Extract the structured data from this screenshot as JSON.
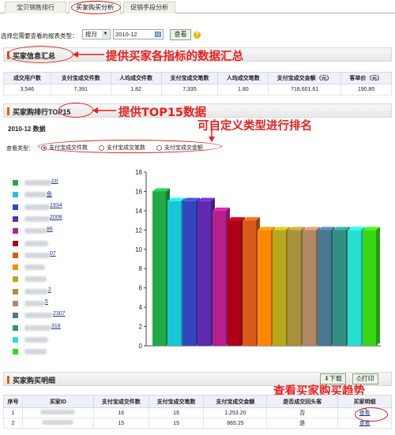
{
  "tabs": [
    {
      "label": "宝贝销售排行"
    },
    {
      "label": "买家购买分析"
    },
    {
      "label": "促销手段分析"
    }
  ],
  "query": {
    "label": "选择您需要查看的报表类型：",
    "period_value": "按月",
    "date_value": "2010-12",
    "view_button": "查看"
  },
  "summary": {
    "title": "买家信息汇总",
    "annotation": "提供买家各指标的数据汇总",
    "headers": [
      "成交用户数",
      "支付宝成交件数",
      "人均成交件数",
      "支付宝成交笔数",
      "人均成交笔数",
      "支付宝成交金额（元）",
      "客单价（元）"
    ],
    "values": [
      "3,546",
      "7,391",
      "1.82",
      "7,335",
      "1.80",
      "718,601.61",
      "190.80"
    ]
  },
  "top": {
    "title_prefix": "买家购排行",
    "title_highlight": "TOP15",
    "annotation": "提供TOP15数据",
    "annotation2": "可自定义类型进行排名",
    "data_label": "2010-12 数据",
    "type_label": "查看类型：",
    "radio_options": [
      "支付宝成交件数",
      "支付宝成交笔数",
      "支付宝成交金额"
    ],
    "selected_index": 0
  },
  "legend": [
    {
      "label": "zzi",
      "color": "#22aa44"
    },
    {
      "label": "鱼",
      "color": "#19c6d9"
    },
    {
      "label": "1934",
      "color": "#3346c0"
    },
    {
      "label": "2008",
      "color": "#5d2ab0"
    },
    {
      "label": "86",
      "color": "#b4208c"
    },
    {
      "label": "",
      "color": "#b00018"
    },
    {
      "label": "07",
      "color": "#d85a18"
    },
    {
      "label": "",
      "color": "#ff8800"
    },
    {
      "label": "",
      "color": "#b7a91d"
    },
    {
      "label": "2",
      "color": "#a8903c"
    },
    {
      "label": "5",
      "color": "#b28766"
    },
    {
      "label": "2307",
      "color": "#4a7890"
    },
    {
      "label": "318",
      "color": "#338f84"
    },
    {
      "label": "",
      "color": "#26e0d2"
    },
    {
      "label": "",
      "color": "#38d616"
    }
  ],
  "chart_data": {
    "type": "bar",
    "ylim": [
      0,
      18
    ],
    "yticks": [
      "0",
      "2",
      "4",
      "6",
      "8",
      "10",
      "12",
      "14",
      "16",
      "18"
    ],
    "values": [
      16,
      15,
      15,
      15,
      14,
      13,
      13,
      12,
      12,
      12,
      12,
      12,
      12,
      12,
      12
    ],
    "colors": [
      "#22aa44",
      "#19c6d9",
      "#3346c0",
      "#5d2ab0",
      "#b4208c",
      "#b00018",
      "#d85a18",
      "#ff8800",
      "#b7a91d",
      "#a8903c",
      "#b28766",
      "#4a7890",
      "#338f84",
      "#26e0d2",
      "#38d616"
    ]
  },
  "detail": {
    "title": "买家购买明细",
    "download": "下载",
    "print": "打印",
    "annotation": "查看买家购买趋势",
    "headers": [
      "序号",
      "买家ID",
      "支付宝成交件数",
      "支付宝成交笔数",
      "支付宝成交金额",
      "是否成交回头客",
      "买家明细"
    ],
    "rows": [
      {
        "index": "1",
        "count": "16",
        "orders": "16",
        "amount": "1,253.20",
        "repeat": "否",
        "action": "查看"
      },
      {
        "index": "2",
        "count": "15",
        "orders": "15",
        "amount": "865.25",
        "repeat": "是",
        "action": "查看"
      }
    ]
  }
}
